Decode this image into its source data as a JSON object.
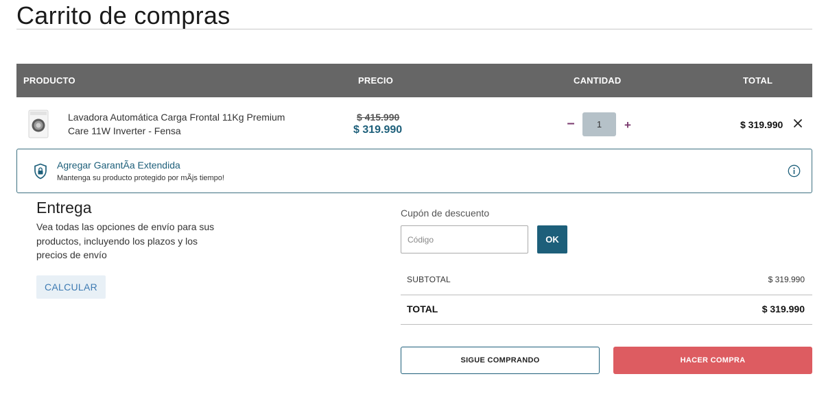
{
  "page": {
    "title": "Carrito de compras"
  },
  "table": {
    "headers": {
      "product": "PRODUCTO",
      "price": "PRECIO",
      "quantity": "CANTIDAD",
      "total": "TOTAL"
    }
  },
  "cart_item": {
    "image_icon": "washing-machine-icon",
    "name": "Lavadora Automática Carga Frontal 11Kg Premium Care 11W Inverter - Fensa",
    "old_price": "$ 415.990",
    "price": "$ 319.990",
    "quantity": "1",
    "minus_label": "–",
    "plus_label": "+",
    "line_total": "$ 319.990",
    "remove_icon": "close-icon"
  },
  "warranty": {
    "title": "Agregar GarantÃa Extendida",
    "subtitle": "Mantenga su producto protegido por mÃjs tiempo!",
    "shield_icon": "shield-lock-icon",
    "info_icon": "info-icon"
  },
  "delivery": {
    "title": "Entrega",
    "description": "Vea todas las opciones de envío para sus productos, incluyendo los plazos y los precios de envío",
    "calculate_label": "CALCULAR"
  },
  "coupon": {
    "label": "Cupón de descuento",
    "placeholder": "Código",
    "value": "",
    "ok_label": "OK"
  },
  "summary": {
    "subtotal_label": "SUBTOTAL",
    "subtotal_value": "$ 319.990",
    "total_label": "TOTAL",
    "total_value": "$ 319.990"
  },
  "actions": {
    "continue_label": "SIGUE COMPRANDO",
    "checkout_label": "HACER COMPRA"
  },
  "colors": {
    "header_bg": "#666666",
    "accent_teal": "#1d5f7a",
    "quantity_accent": "#7b3b6f",
    "checkout_red": "#dd5c61",
    "calc_bg": "#e8f0f6"
  }
}
